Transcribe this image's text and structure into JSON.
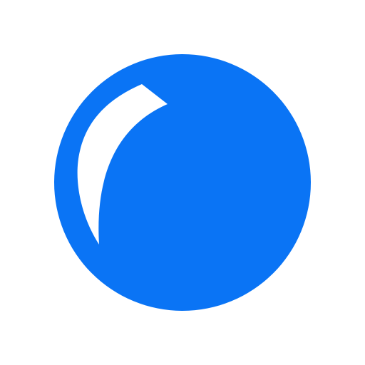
{
  "icon": {
    "name": "blue-sphere-icon",
    "shape": "circle",
    "fill_color": "#0A74F5",
    "highlight_color": "#FFFFFF",
    "background_color": "#FFFFFF"
  }
}
